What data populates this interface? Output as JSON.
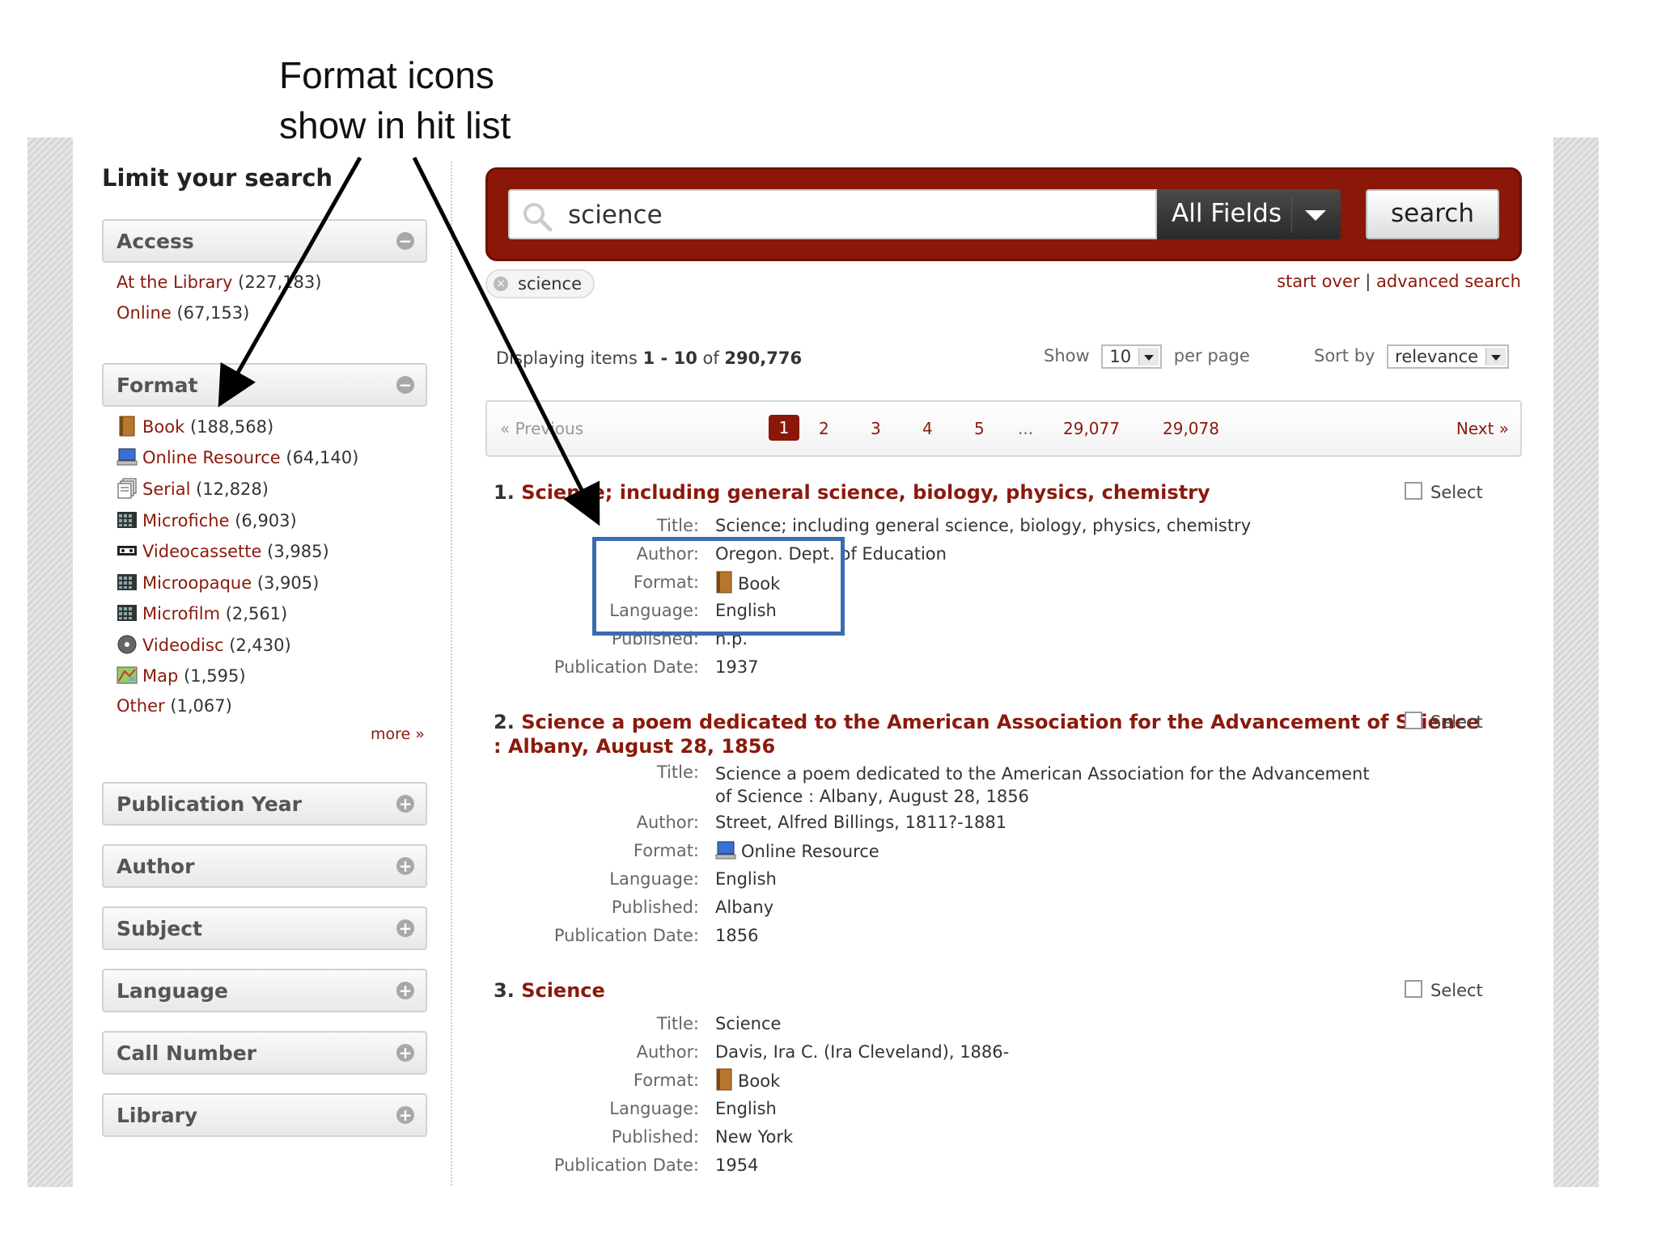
{
  "annotation": {
    "line1": "Format icons",
    "line2": "show in hit list"
  },
  "sidebar": {
    "heading": "Limit your search",
    "access": {
      "title": "Access",
      "items": [
        {
          "label": "At the Library",
          "count": "(227,183)"
        },
        {
          "label": "Online",
          "count": "(67,153)"
        }
      ]
    },
    "format": {
      "title": "Format",
      "items": [
        {
          "label": "Book",
          "count": "(188,568)",
          "icon": "book-icon"
        },
        {
          "label": "Online Resource",
          "count": "(64,140)",
          "icon": "computer-icon"
        },
        {
          "label": "Serial",
          "count": "(12,828)",
          "icon": "serial-icon"
        },
        {
          "label": "Microfiche",
          "count": "(6,903)",
          "icon": "film-grid-icon"
        },
        {
          "label": "Videocassette",
          "count": "(3,985)",
          "icon": "videocassette-icon"
        },
        {
          "label": "Microopaque",
          "count": "(3,905)",
          "icon": "film-grid-icon"
        },
        {
          "label": "Microfilm",
          "count": "(2,561)",
          "icon": "film-grid-icon"
        },
        {
          "label": "Videodisc",
          "count": "(2,430)",
          "icon": "disc-icon"
        },
        {
          "label": "Map",
          "count": "(1,595)",
          "icon": "map-icon"
        },
        {
          "label": "Other",
          "count": "(1,067)"
        }
      ],
      "more": "more »"
    },
    "collapsed_facets": [
      "Publication Year",
      "Author",
      "Subject",
      "Language",
      "Call Number",
      "Library"
    ]
  },
  "search": {
    "query": "science",
    "field": "All Fields",
    "button": "search",
    "chip": "science",
    "start_over": "start over",
    "separator": "|",
    "advanced": "advanced search"
  },
  "results_info": {
    "prefix": "Displaying items ",
    "from": "1",
    "dash": " - ",
    "to": "10",
    "of": " of ",
    "total": "290,776",
    "show_label": "Show",
    "per_page_value": "10",
    "per_page_label": "per page",
    "sort_label": "Sort by",
    "sort_value": "relevance"
  },
  "pager": {
    "prev": "« Previous",
    "pages": [
      "1",
      "2",
      "3",
      "4",
      "5"
    ],
    "ellipsis": "...",
    "last_pages": [
      "29,077",
      "29,078"
    ],
    "next": "Next »"
  },
  "labels": {
    "title": "Title:",
    "author": "Author:",
    "format": "Format:",
    "language": "Language:",
    "published": "Published:",
    "publication_date": "Publication Date:",
    "select": "Select"
  },
  "results": [
    {
      "num": "1.",
      "heading": "Science; including general science, biology, physics, chemistry",
      "title": "Science; including general science, biology, physics, chemistry",
      "author": "Oregon. Dept. of Education",
      "format": "Book",
      "language": "English",
      "published": "n.p.",
      "date": "1937"
    },
    {
      "num": "2.",
      "heading_line1": "Science a poem dedicated to the American Association for the Advancement of Science",
      "heading_line2": ": Albany, August 28, 1856",
      "title_line1": "Science a poem dedicated to the American Association for the Advancement",
      "title_line2": "of Science : Albany, August 28, 1856",
      "author": "Street, Alfred Billings, 1811?-1881",
      "format": "Online Resource",
      "language": "English",
      "published": "Albany",
      "date": "1856"
    },
    {
      "num": "3.",
      "heading": "Science",
      "title": "Science",
      "author": "Davis, Ira C. (Ira Cleveland), 1886-",
      "format": "Book",
      "language": "English",
      "published": "New York",
      "date": "1954"
    }
  ],
  "colors": {
    "accent": "#8a1708",
    "link": "#8a1a0d",
    "highlight": "#3b6cb0"
  }
}
